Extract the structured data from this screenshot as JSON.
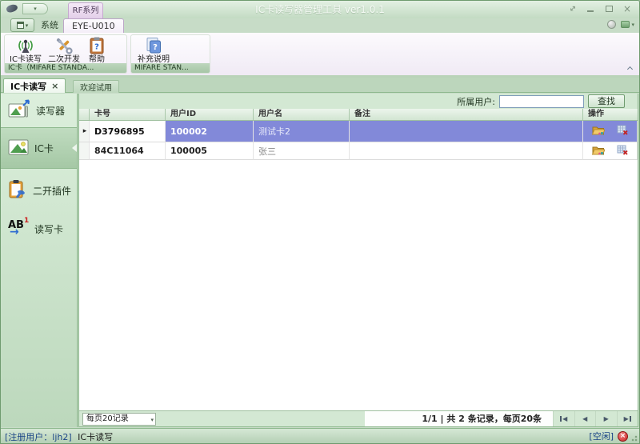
{
  "window": {
    "app_title": "IC卡读写器管理工具 ver1.0.1",
    "contextual_tab": "RF系列"
  },
  "ribbon": {
    "tabs": {
      "system": "系统",
      "device": "EYE-U010"
    },
    "buttons": {
      "ic_rw": "IC卡读写",
      "dev": "二次开发",
      "help": "帮助",
      "supplement": "补充说明"
    },
    "group_captions": {
      "g1": "IC卡（MIFARE STANDA...",
      "g2": "MIFARE STAN..."
    }
  },
  "doc_tabs": {
    "active": "IC卡读写",
    "close": "×",
    "inactive": "欢迎试用"
  },
  "sidebar": {
    "items": [
      {
        "label": "读写器"
      },
      {
        "label": "IC卡"
      },
      {
        "label": "二开插件"
      },
      {
        "label": "读写卡"
      }
    ]
  },
  "search": {
    "label": "所属用户:",
    "value": "",
    "button": "查找"
  },
  "table": {
    "headers": {
      "card": "卡号",
      "uid": "用户ID",
      "uname": "用户名",
      "remark": "备注",
      "ops": "操作"
    },
    "rows": [
      {
        "card": "D3796895",
        "uid": "100002",
        "uname": "测试卡2",
        "remark": "",
        "selected": true
      },
      {
        "card": "84C11064",
        "uid": "100005",
        "uname": "张三",
        "remark": "",
        "selected": false
      }
    ],
    "row_indicator": "▸"
  },
  "pagination": {
    "page_size": "每页20记录",
    "info": "1/1 | 共 2 条记录，每页20条"
  },
  "status": {
    "left_user": "[注册用户：ljh2]",
    "left_page": "IC卡读写",
    "right_idle": "[空闲]"
  },
  "icons": {
    "antenna-icon": "svg-antenna",
    "tools-icon": "svg-crossed-tools",
    "clipboard-question-icon": "svg-clipboard-?",
    "pages-question-icon": "svg-pages-?",
    "reader-icon": "svg-image-arrow",
    "ic-card-icon": "svg-image",
    "plugin-icon": "svg-clipboard-wrench",
    "rw-card-icon": "AB1-arrow",
    "folder-icon": "svg-open-folder",
    "table-delete-icon": "svg-grid-red-x",
    "close-icon": "×",
    "minimize-icon": "bar",
    "maximize-icon": "box",
    "fit-icon": "diag-arrows"
  },
  "colors": {
    "theme_green": "#c7dcc7",
    "selection_blue": "#8289d9",
    "tab_lavender": "#f4eef8"
  }
}
